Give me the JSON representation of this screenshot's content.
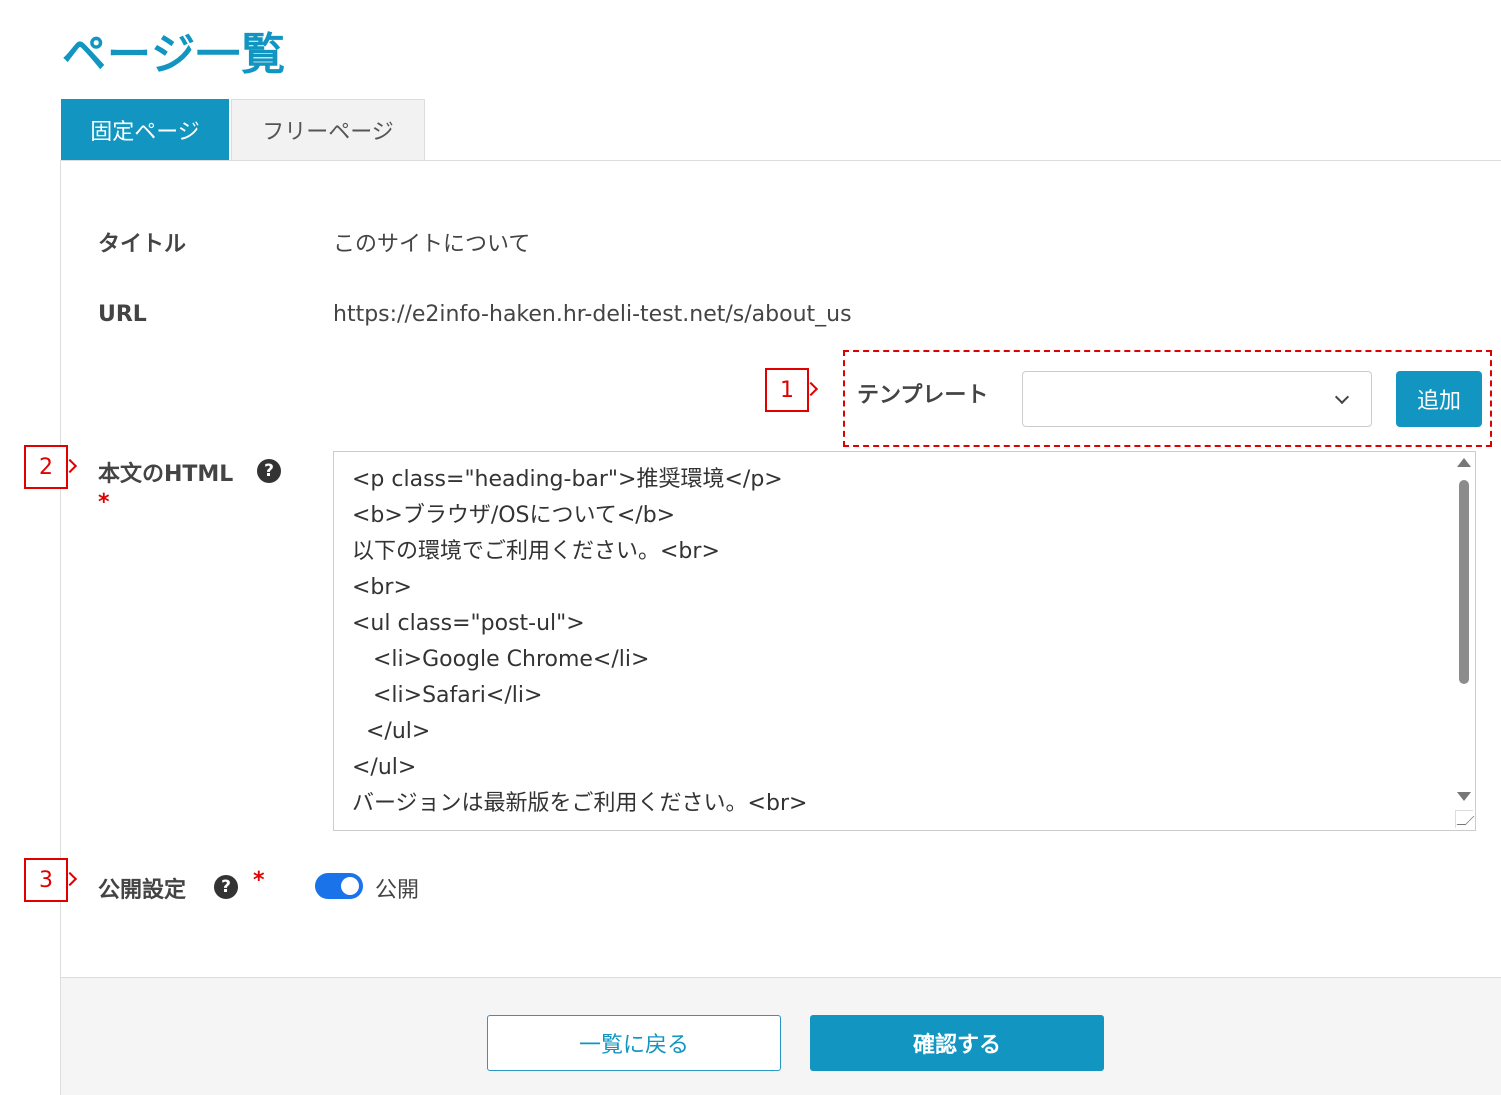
{
  "page": {
    "title": "ページ一覧"
  },
  "colors": {
    "primary": "#1296c1",
    "annotation_red": "#e00000",
    "toggle_blue": "#1a73e8"
  },
  "tabs": [
    {
      "label": "固定ページ",
      "active": true
    },
    {
      "label": "フリーページ",
      "active": false
    }
  ],
  "form": {
    "title": {
      "label": "タイトル",
      "value": "このサイトについて"
    },
    "url": {
      "label": "URL",
      "value": "https://e2info-haken.hr-deli-test.net/s/about_us"
    },
    "template": {
      "label": "テンプレート",
      "selected": "",
      "add_label": "追加"
    },
    "body_html": {
      "label": "本文のHTML",
      "required_mark": "*",
      "help_icon": "question-circle-icon",
      "lines": [
        "<p class=\"heading-bar\">推奨環境</p>",
        "<b>ブラウザ/OSについて</b>",
        "以下の環境でご利用ください。<br>",
        "<br>",
        "<ul class=\"post-ul\">",
        "   <li>Google Chrome</li>",
        "   <li>Safari</li>",
        "  </ul>",
        "</ul>",
        "バージョンは最新版をご利用ください。<br>"
      ]
    },
    "publish": {
      "label": "公開設定",
      "required_mark": "*",
      "help_icon": "question-circle-icon",
      "toggle_on": true,
      "toggle_label": "公開"
    }
  },
  "annotations": {
    "callout_1": "1",
    "callout_2": "2",
    "callout_3": "3"
  },
  "footer": {
    "back_label": "一覧に戻る",
    "confirm_label": "確認する"
  }
}
